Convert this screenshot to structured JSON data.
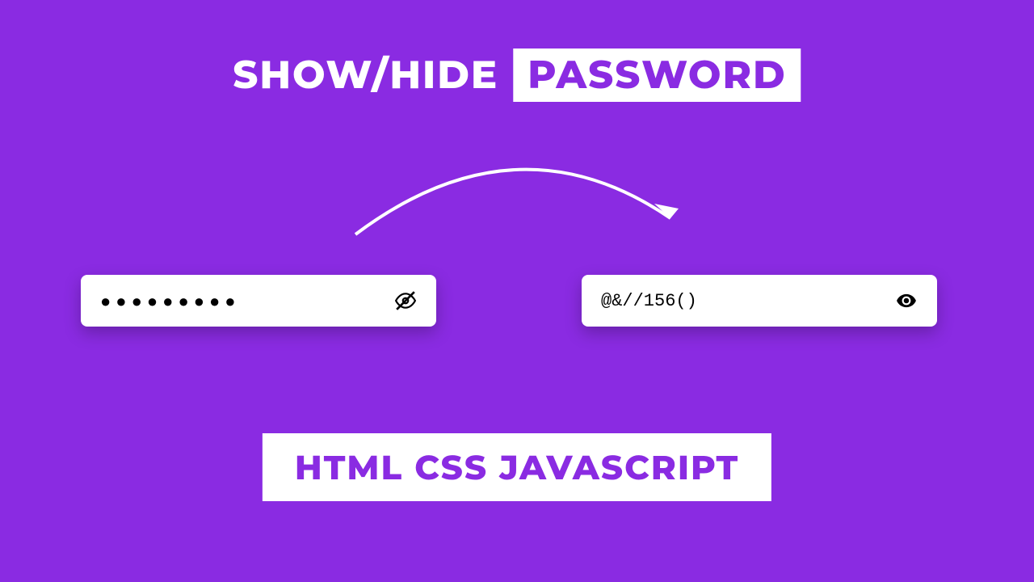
{
  "title": {
    "prefix": "SHOW/HIDE",
    "highlight": "PASSWORD"
  },
  "inputs": {
    "hidden": {
      "value": "●●●●●●●●●"
    },
    "visible": {
      "value": "@&//156()"
    }
  },
  "footer": {
    "label": "HTML CSS JAVASCRIPT"
  }
}
